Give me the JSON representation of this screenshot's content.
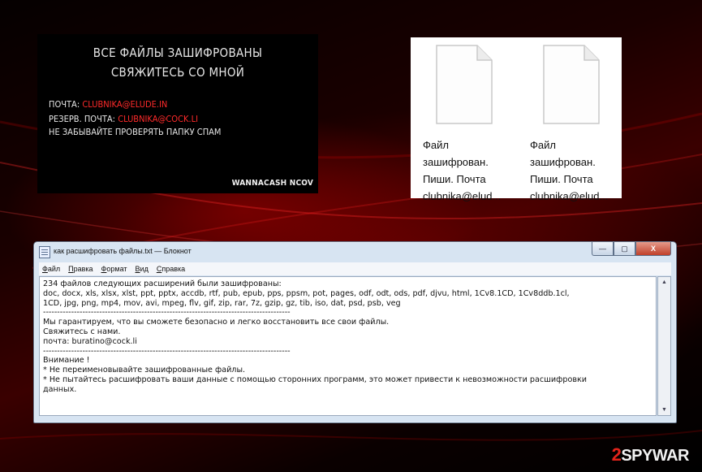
{
  "banner": {
    "line1": "ВСЕ ФАЙЛЫ ЗАШИФРОВАНЫ",
    "line2": "СВЯЖИТЕСЬ СО МНОЙ",
    "mail_label": "ПОЧТА:",
    "mail_value": "CLUBNIKA@ELUDE.IN",
    "reserve_label": "РЕЗЕРВ. ПОЧТА:",
    "reserve_value": "CLUBNIKA@COCK.LI",
    "spam_note": "НЕ ЗАБЫВАЙТЕ ПРОВЕРЯТЬ ПАПКУ СПАМ",
    "brand": "WANNACASH NCOV"
  },
  "files": [
    {
      "lines": [
        "Файл",
        "зашифрован.",
        "Пиши. Почта",
        "clubnika@elud..."
      ]
    },
    {
      "lines": [
        "Файл",
        "зашифрован.",
        "Пиши. Почта",
        "clubnika@elud..."
      ]
    }
  ],
  "notepad": {
    "title": "как расшифровать файлы.txt — Блокнот",
    "buttons": {
      "minimize": "—",
      "maximize": "▢",
      "close": "X"
    },
    "menu": [
      "Файл",
      "Правка",
      "Формат",
      "Вид",
      "Справка"
    ],
    "lines": [
      "234 файлов следующих расширений были зашифрованы:",
      " doc, docx, xls, xlsx, xlst, ppt, pptx, accdb, rtf, pub, epub, pps, ppsm, pot, pages, odf, odt, ods, pdf, djvu, html, 1Cv8.1CD, 1Cv8ddb.1cl,",
      "1CD, jpg, png, mp4, mov, avi, mpeg, flv, gif, zip, rar, 7z, gzip, gz, tib, iso, dat, psd, psb, veg",
      "----------------------------------------------------------------------------------------",
      "Мы гарантируем, что вы сможете безопасно и легко восстановить все свои файлы.",
      "Свяжитесь с нами.",
      "почта: buratino@cock.li",
      "----------------------------------------------------------------------------------------",
      "Внимание !",
      "* Не переименовывайте зашифрованные файлы.",
      "* Не пытайтесь расшифровать ваши данные с помощью сторонних программ, это может привести к невозможности расшифровки",
      "данных."
    ]
  },
  "watermark": {
    "digit": "2",
    "text": "SPYWAR"
  }
}
